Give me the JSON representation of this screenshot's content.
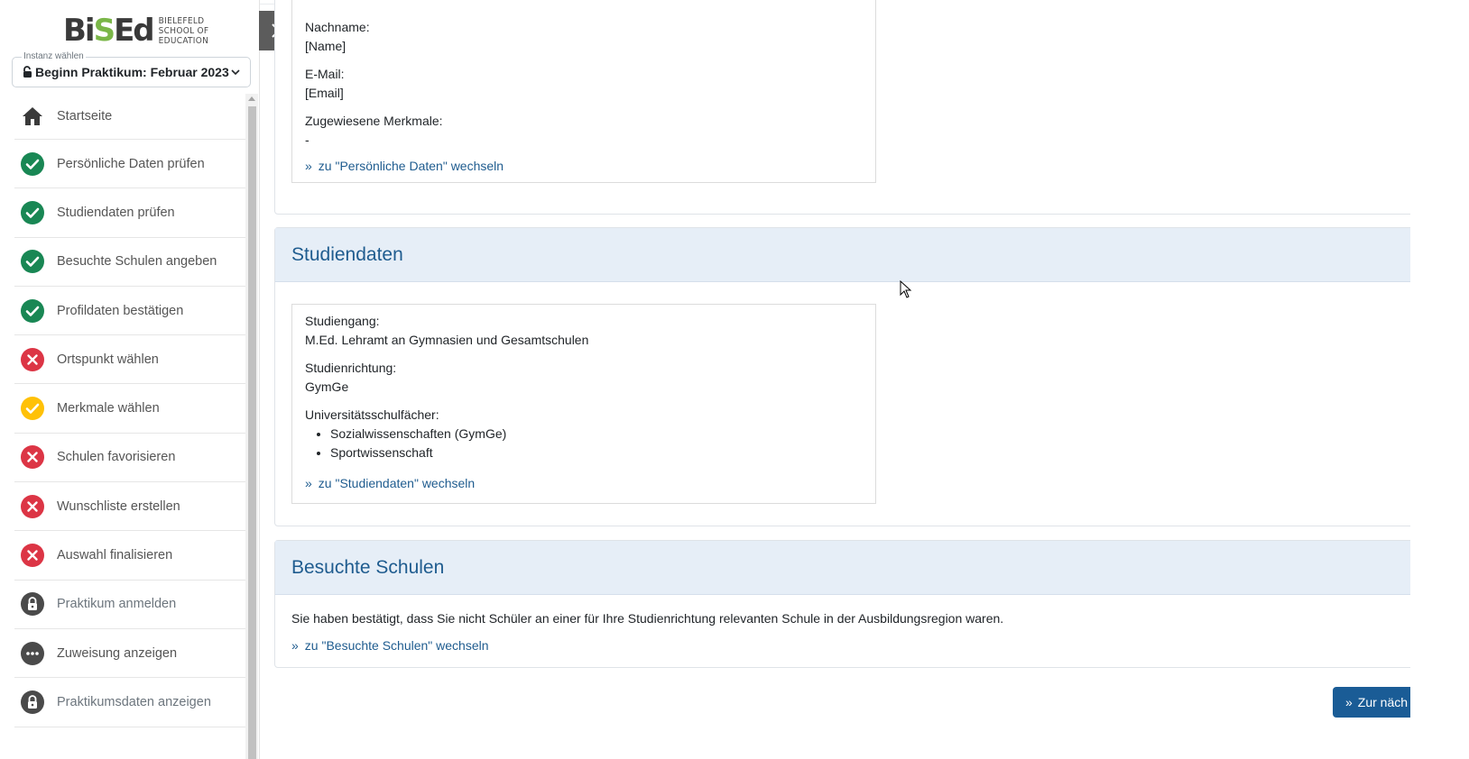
{
  "logo": {
    "word_dark": "Bi",
    "word_green": "S",
    "word_rest": "Ed",
    "line1": "BIELEFELD",
    "line2": "SCHOOL OF",
    "line3": "EDUCATION"
  },
  "instance": {
    "legend": "Instanz wählen",
    "value": "Beginn Praktikum: Februar 2023"
  },
  "nav": [
    {
      "label": "Startseite",
      "status": "home"
    },
    {
      "label": "Persönliche Daten prüfen",
      "status": "done"
    },
    {
      "label": "Studiendaten prüfen",
      "status": "done"
    },
    {
      "label": "Besuchte Schulen angeben",
      "status": "done"
    },
    {
      "label": "Profildaten bestätigen",
      "status": "done"
    },
    {
      "label": "Ortspunkt wählen",
      "status": "error"
    },
    {
      "label": "Merkmale wählen",
      "status": "partial"
    },
    {
      "label": "Schulen favorisieren",
      "status": "error"
    },
    {
      "label": "Wunschliste erstellen",
      "status": "error"
    },
    {
      "label": "Auswahl finalisieren",
      "status": "error"
    },
    {
      "label": "Praktikum anmelden",
      "status": "locked"
    },
    {
      "label": "Zuweisung anzeigen",
      "status": "pending"
    },
    {
      "label": "Praktikumsdaten anzeigen",
      "status": "locked"
    }
  ],
  "personal": {
    "nachname_label": "Nachname:",
    "nachname_value": "[Name]",
    "email_label": "E-Mail:",
    "email_value": "[Email]",
    "merkmale_label": "Zugewiesene Merkmale:",
    "merkmale_value": "-",
    "link": "zu \"Persönliche Daten\" wechseln"
  },
  "studiendaten": {
    "title": "Studiendaten",
    "studiengang_label": "Studiengang:",
    "studiengang_value": "M.Ed. Lehramt an Gymnasien und Gesamtschulen",
    "richtung_label": "Studienrichtung:",
    "richtung_value": "GymGe",
    "faecher_label": "Universitätsschulfächer:",
    "faecher": [
      "Sozialwissenschaften (GymGe)",
      "Sportwissenschaft"
    ],
    "link": "zu \"Studiendaten\" wechseln"
  },
  "schulen": {
    "title": "Besuchte Schulen",
    "text": "Sie haben bestätigt, dass Sie nicht Schüler an einer für Ihre Studienrichtung relevanten Schule in der Ausbildungsregion waren.",
    "link": "zu \"Besuchte Schulen\" wechseln"
  },
  "next_button": "Zur näch",
  "colors": {
    "done": "#198754",
    "error": "#dc3545",
    "partial": "#ffc107",
    "locked": "#4a4a4a",
    "accent": "#1f5c8f"
  }
}
